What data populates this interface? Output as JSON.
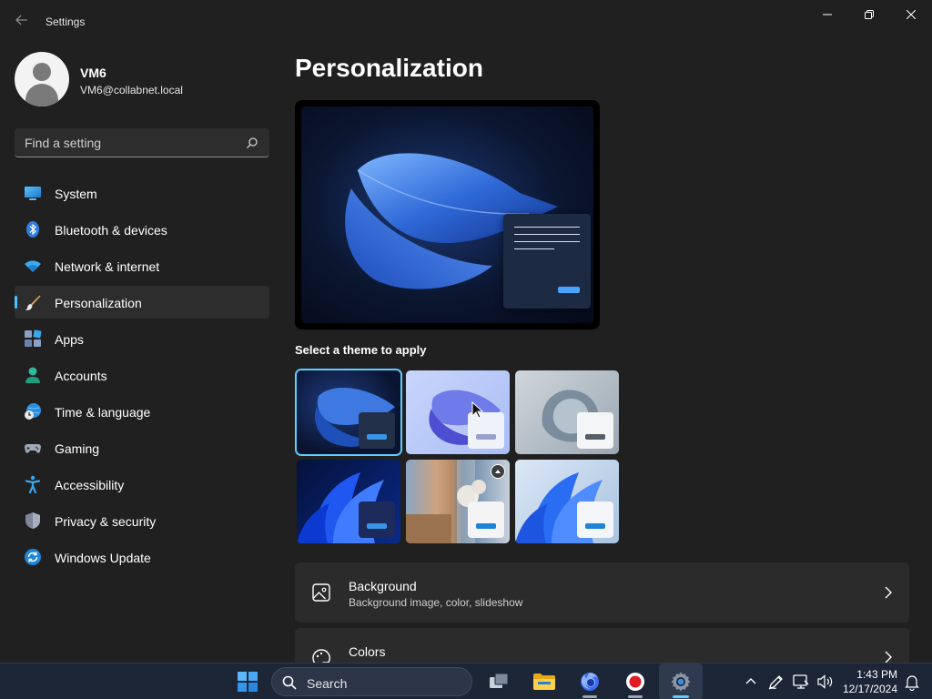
{
  "window": {
    "title": "Settings",
    "back_icon": "back-arrow-icon",
    "controls": [
      "minimize-icon",
      "restore-icon",
      "close-icon"
    ]
  },
  "profile": {
    "name": "VM6",
    "email": "VM6@collabnet.local"
  },
  "search": {
    "placeholder": "Find a setting"
  },
  "nav": {
    "items": [
      {
        "label": "System",
        "icon": "system-icon"
      },
      {
        "label": "Bluetooth & devices",
        "icon": "bluetooth-icon"
      },
      {
        "label": "Network & internet",
        "icon": "wifi-icon"
      },
      {
        "label": "Personalization",
        "icon": "paintbrush-icon",
        "active": true
      },
      {
        "label": "Apps",
        "icon": "apps-icon"
      },
      {
        "label": "Accounts",
        "icon": "person-icon"
      },
      {
        "label": "Time & language",
        "icon": "globe-clock-icon"
      },
      {
        "label": "Gaming",
        "icon": "gamepad-icon"
      },
      {
        "label": "Accessibility",
        "icon": "accessibility-icon"
      },
      {
        "label": "Privacy & security",
        "icon": "shield-icon"
      },
      {
        "label": "Windows Update",
        "icon": "update-icon"
      }
    ]
  },
  "main": {
    "title": "Personalization",
    "themes_label": "Select a theme to apply",
    "themes": [
      {
        "name": "windows-dark",
        "selected": true
      },
      {
        "name": "windows-light",
        "selected": false
      },
      {
        "name": "glow",
        "selected": false
      },
      {
        "name": "captured-motion",
        "selected": false
      },
      {
        "name": "flow",
        "selected": false
      },
      {
        "name": "sunrise",
        "selected": false
      }
    ],
    "cards": [
      {
        "title": "Background",
        "subtitle": "Background image, color, slideshow",
        "icon": "image-icon"
      },
      {
        "title": "Colors",
        "subtitle": "",
        "icon": "palette-icon"
      }
    ]
  },
  "taskbar": {
    "search_label": "Search",
    "time": "1:43 PM",
    "date": "12/17/2024",
    "accent": "#60cdff"
  }
}
